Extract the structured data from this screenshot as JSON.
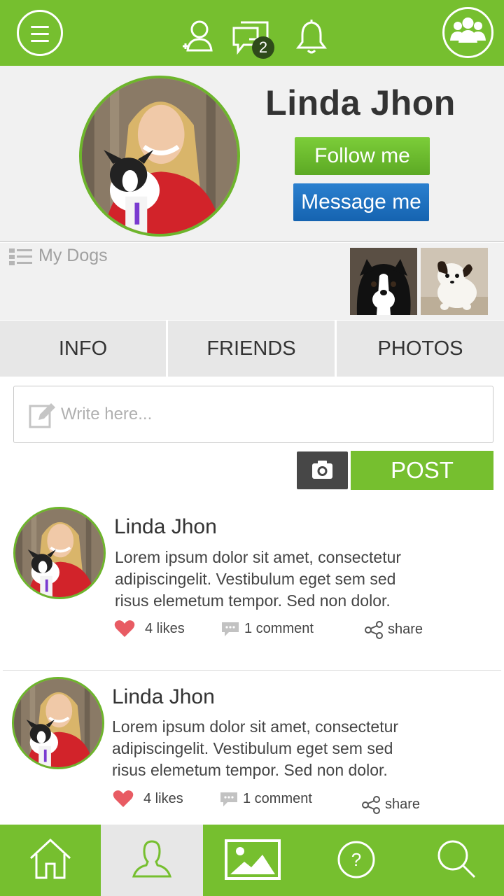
{
  "topbar": {
    "notification_count": "2",
    "icons": [
      "menu-icon",
      "add-friend-icon",
      "messages-icon",
      "bell-icon",
      "group-icon"
    ],
    "accent_color": "#76bf2f"
  },
  "profile": {
    "name": "Linda Jhon",
    "follow_label": "Follow me",
    "message_label": "Message me"
  },
  "dogs": {
    "label": "My Dogs"
  },
  "tabs": [
    {
      "label": "INFO"
    },
    {
      "label": "FRIENDS"
    },
    {
      "label": "PHOTOS"
    }
  ],
  "composer": {
    "placeholder": "Write here...",
    "post_label": "POST"
  },
  "posts": [
    {
      "author": "Linda Jhon",
      "text_lines": [
        "Lorem ipsum dolor sit amet, consectetur",
        "adipiscingelit. Vestibulum eget sem sed",
        "risus elemetum tempor. Sed non dolor."
      ],
      "likes": "4 likes",
      "comments": "1 comment",
      "share": "share"
    },
    {
      "author": "Linda Jhon",
      "text_lines": [
        "Lorem ipsum dolor sit amet, consectetur",
        "adipiscingelit. Vestibulum eget sem sed",
        "risus elemetum tempor. Sed non dolor."
      ],
      "likes": "4 likes",
      "comments": "1 comment",
      "share": "share"
    }
  ],
  "bottom_nav": {
    "items": [
      "home-icon",
      "profile-icon",
      "gallery-icon",
      "help-icon",
      "search-icon"
    ],
    "active": "profile-icon"
  }
}
